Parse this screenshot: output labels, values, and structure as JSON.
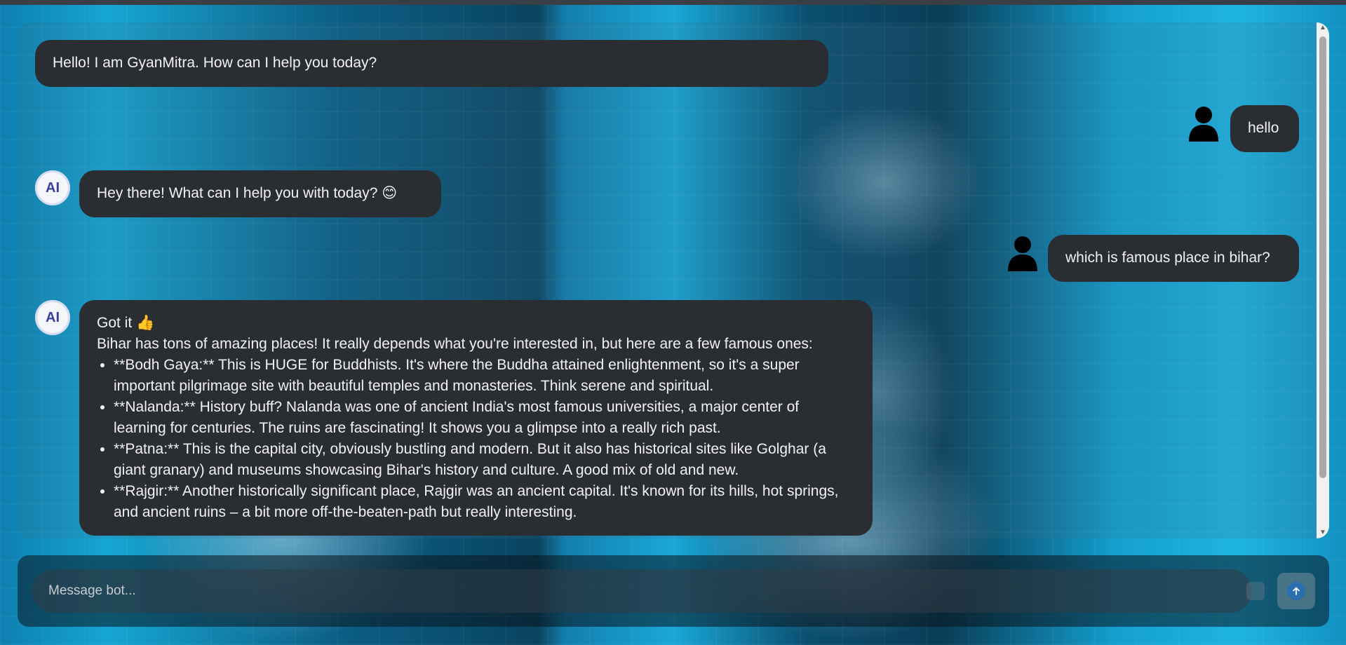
{
  "messages": [
    {
      "role": "bot",
      "text": "Hello! I am GyanMitra. How can I help you today?"
    },
    {
      "role": "user",
      "text": "hello"
    },
    {
      "role": "bot",
      "text": "Hey there! What can I help you with today? 😊"
    },
    {
      "role": "user",
      "text": "which is famous place in bihar?"
    },
    {
      "role": "bot",
      "intro": "Got it 👍",
      "text": "Bihar has tons of amazing places! It really depends what you're interested in, but here are a few famous ones:",
      "items": [
        "**Bodh Gaya:** This is HUGE for Buddhists. It's where the Buddha attained enlightenment, so it's a super important pilgrimage site with beautiful temples and monasteries. Think serene and spiritual.",
        "**Nalanda:** History buff? Nalanda was one of ancient India's most famous universities, a major center of learning for centuries. The ruins are fascinating! It shows you a glimpse into a really rich past.",
        "**Patna:** This is the capital city, obviously bustling and modern. But it also has historical sites like Golghar (a giant granary) and museums showcasing Bihar's history and culture. A good mix of old and new.",
        "**Rajgir:** Another historically significant place, Rajgir was an ancient capital. It's known for its hills, hot springs, and ancient ruins – a bit more off-the-beaten-path but really interesting."
      ]
    }
  ],
  "avatar": {
    "ai_label": "AI"
  },
  "composer": {
    "placeholder": "Message bot..."
  },
  "icons": {
    "send": "arrow-up-icon",
    "user": "user-silhouette-icon",
    "mic": "mic-icon"
  },
  "colors": {
    "bubble": "#2a2d31",
    "text": "#f2f2f2",
    "send": "#2b6fb0"
  }
}
